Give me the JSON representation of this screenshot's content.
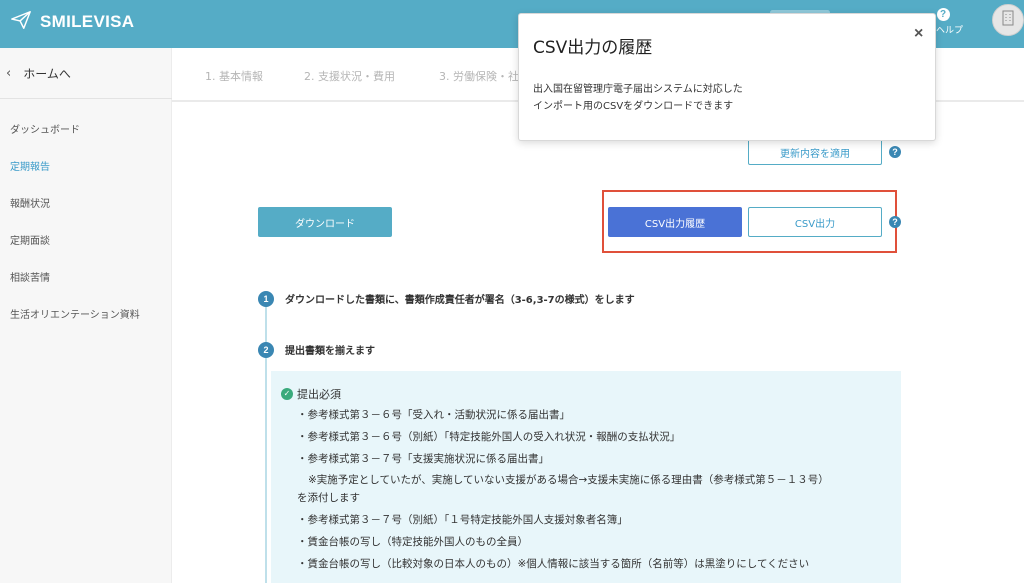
{
  "header": {
    "app_name": "SMILEVISA",
    "help_label": "ヘルプ",
    "colors": {
      "bar": "#55acc6"
    }
  },
  "sidebar": {
    "home_label": "ホームへ",
    "items": [
      {
        "label": "ダッシュボード",
        "active": false
      },
      {
        "label": "定期報告",
        "active": true
      },
      {
        "label": "報酬状況",
        "active": false
      },
      {
        "label": "定期面談",
        "active": false
      },
      {
        "label": "相談苦情",
        "active": false
      },
      {
        "label": "生活オリエンテーション資料",
        "active": false
      }
    ]
  },
  "steps": [
    {
      "label": "1. 基本情報"
    },
    {
      "label": "2. 支援状況・費用"
    },
    {
      "label": "3. 労働保険・社"
    }
  ],
  "actions": {
    "update_label": "更新内容を適用",
    "download_label": "ダウンロード",
    "history_label": "CSV出力履歴",
    "csv_label": "CSV出力"
  },
  "instructions": {
    "step1": {
      "number": "1",
      "text": "ダウンロードした書類に、書類作成責任者が署名（3-6,3-7の様式）をします"
    },
    "step2": {
      "number": "2",
      "text": "提出書類を揃えます"
    }
  },
  "requirements": {
    "title": "提出必須",
    "lines": [
      "・参考様式第３－６号「受入れ・活動状況に係る届出書」",
      "・参考様式第３－６号（別紙）「特定技能外国人の受入れ状況・報酬の支払状況」",
      "・参考様式第３－７号「支援実施状況に係る届出書」",
      "※実施予定としていたが、実施していない支援がある場合→支援未実施に係る理由書（参考様式第５－１３号）",
      "を添付します",
      "・参考様式第３－７号（別紙）「１号特定技能外国人支援対象者名簿」",
      "・賃金台帳の写し（特定技能外国人のもの全員）",
      "・賃金台帳の写し（比較対象の日本人のもの）※個人情報に該当する箇所（名前等）は黒塗りにしてください"
    ]
  },
  "popover": {
    "title": "CSV出力の履歴",
    "close_glyph": "×",
    "description_line1": "出入国在留管理庁電子届出システムに対応した",
    "description_line2": "インポート用のCSVをダウンロードできます"
  },
  "icons": {
    "logo": "paper-plane-icon",
    "help": "question-circle-icon",
    "avatar": "building-icon",
    "back": "chevron-left-icon",
    "info": "question-circle-icon",
    "check": "check-circle-icon"
  },
  "colors": {
    "primary": "#55acc6",
    "history_button": "#4a72d6",
    "highlight_border": "#e0503a",
    "active_nav": "#3a9bc9",
    "requirements_bg": "#e8f6fa"
  }
}
